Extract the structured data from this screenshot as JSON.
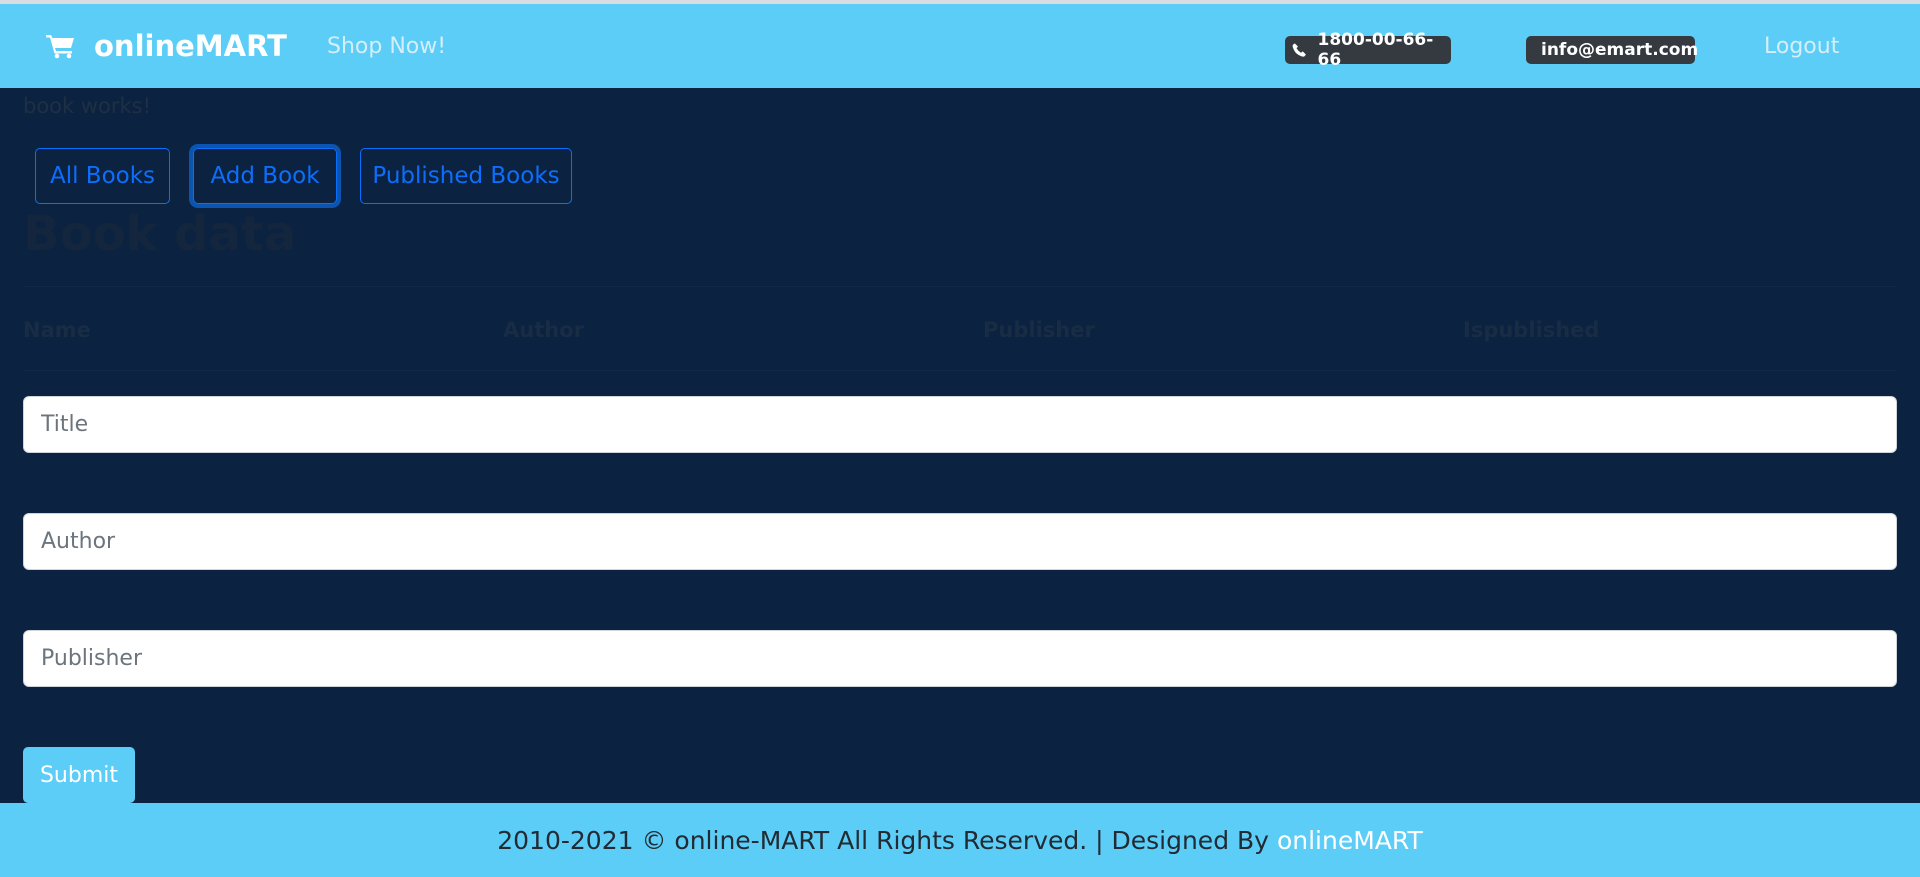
{
  "navbar": {
    "brand": "onlineMART",
    "shop_link": "Shop Now!",
    "phone": "1800-00-66-66",
    "email": "info@emart.com",
    "logout": "Logout"
  },
  "page": {
    "works_text": "book works!",
    "buttons": {
      "all_books": "All Books",
      "add_book": "Add Book",
      "published_books": "Published Books"
    },
    "title": "Book data",
    "table_headers": [
      "Name",
      "Author",
      "Publisher",
      "Ispublished"
    ]
  },
  "form": {
    "title_placeholder": "Title",
    "author_placeholder": "Author",
    "publisher_placeholder": "Publisher",
    "submit_label": "Submit"
  },
  "footer": {
    "text": "2010-2021 © online-MART All Rights Reserved. | Designed By",
    "link": "onlineMART"
  },
  "colors": {
    "navbar_bg": "#5bcdf6",
    "page_bg": "#0b2340",
    "primary_outline": "#0d6efd",
    "badge_bg": "#343a40"
  }
}
